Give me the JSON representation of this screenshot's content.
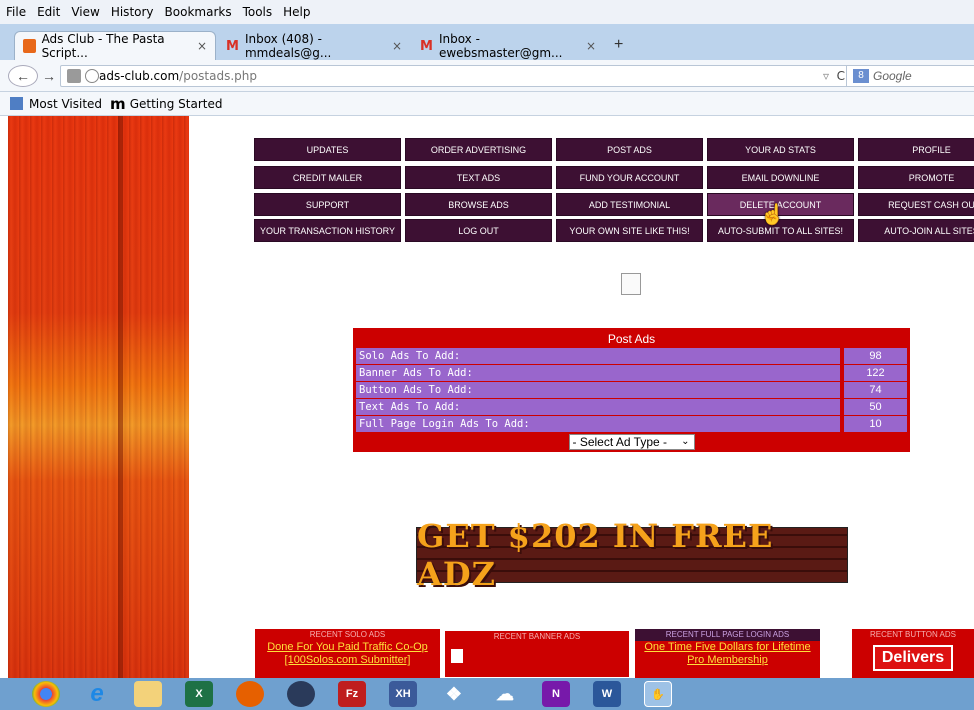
{
  "menubar": {
    "items": [
      "File",
      "Edit",
      "View",
      "History",
      "Bookmarks",
      "Tools",
      "Help"
    ]
  },
  "tabs": [
    {
      "label": "Ads Club - The Pasta Script...",
      "active": true
    },
    {
      "label": "Inbox (408) - mmdeals@g...",
      "active": false
    },
    {
      "label": "Inbox - ewebsmaster@gm...",
      "active": false
    }
  ],
  "address": {
    "host": "ads-club.com",
    "path": "/postads.php"
  },
  "search": {
    "placeholder": "Google"
  },
  "bookmarks": {
    "most_visited": "Most Visited",
    "getting_started": "Getting Started"
  },
  "nav": {
    "rows": [
      [
        "UPDATES",
        "ORDER ADVERTISING",
        "POST ADS",
        "YOUR AD STATS",
        "PROFILE"
      ],
      [
        "CREDIT MAILER",
        "TEXT ADS",
        "FUND YOUR ACCOUNT",
        "EMAIL DOWNLINE",
        "PROMOTE"
      ],
      [
        "SUPPORT",
        "BROWSE ADS",
        "ADD TESTIMONIAL",
        "DELETE ACCOUNT",
        "REQUEST CASH OU"
      ],
      [
        "YOUR TRANSACTION HISTORY",
        "LOG OUT",
        "YOUR OWN SITE LIKE THIS!",
        "AUTO-SUBMIT TO ALL SITES!",
        "AUTO-JOIN ALL SITES"
      ]
    ]
  },
  "postads": {
    "title": "Post Ads",
    "rows": [
      {
        "label": "Solo Ads To Add:",
        "value": "98"
      },
      {
        "label": "Banner Ads To Add:",
        "value": "122"
      },
      {
        "label": "Button Ads To Add:",
        "value": "74"
      },
      {
        "label": "Text Ads To Add:",
        "value": "50"
      },
      {
        "label": "Full Page Login Ads To Add:",
        "value": "10"
      }
    ],
    "select_label": "- Select Ad Type -"
  },
  "banner": {
    "text": "GET $202 IN FREE ADZ"
  },
  "recent": {
    "solo": {
      "heading": "RECENT SOLO ADS",
      "link": "Done For You Paid Traffic Co-Op [100Solos.com Submitter]"
    },
    "banner": {
      "heading": "RECENT BANNER ADS"
    },
    "fullpage": {
      "heading": "RECENT FULL PAGE LOGIN ADS",
      "link": "One Time Five Dollars for Lifetime Pro Membership"
    },
    "button": {
      "heading": "RECENT BUTTON ADS",
      "link": "Delivers"
    }
  },
  "taskbar": {
    "icons": [
      "chrome-icon",
      "ie-icon",
      "file-explorer-icon",
      "excel-icon",
      "firefox-icon",
      "media-player-icon",
      "filezilla-icon",
      "xh-icon",
      "dropbox-icon",
      "onedrive-icon",
      "onenote-icon",
      "word-icon",
      "hand-icon"
    ]
  }
}
